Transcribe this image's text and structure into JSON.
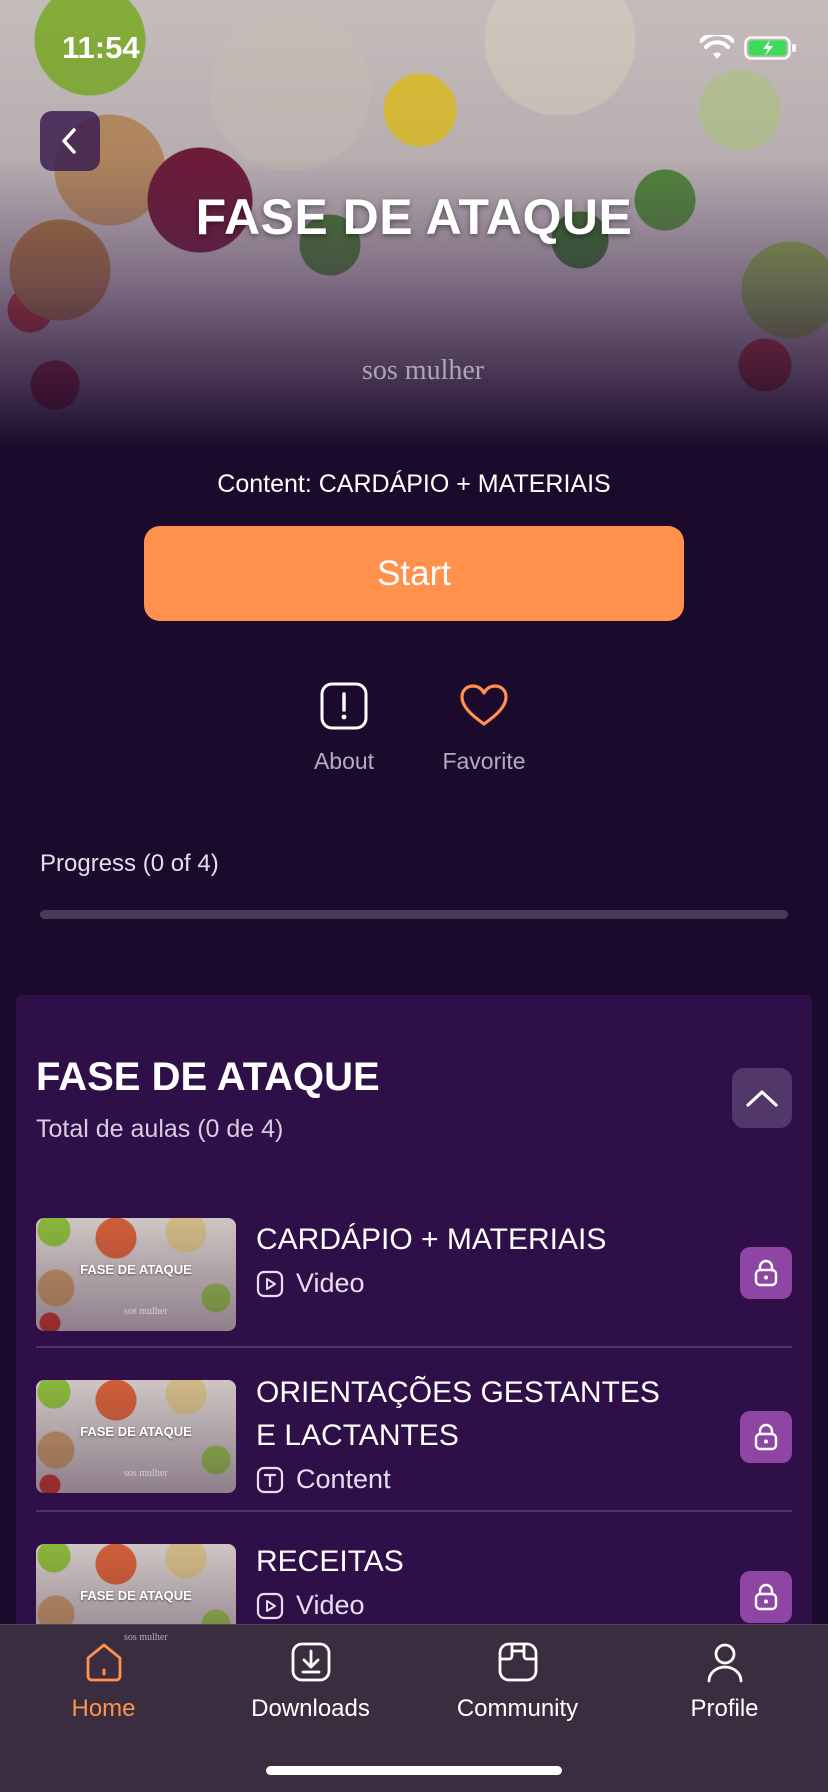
{
  "status_bar": {
    "time": "11:54",
    "wifi_icon": "wifi-icon",
    "battery_icon": "battery-charging-icon"
  },
  "hero": {
    "title": "FASE DE ATAQUE",
    "logo_text": "sos mulher",
    "back_icon": "chevron-left-icon"
  },
  "course": {
    "content_label": "Content: CARDÁPIO + MATERIAIS",
    "start_label": "Start",
    "about_label": "About",
    "favorite_label": "Favorite",
    "progress_label": "Progress (0 of 4)",
    "progress_fraction": 0
  },
  "module": {
    "title": "FASE DE ATAQUE",
    "subtitle": "Total de aulas (0 de 4)",
    "collapse_icon": "chevron-up-icon",
    "lessons": [
      {
        "title": "CARDÁPIO + MATERIAIS",
        "type": "Video",
        "type_icon": "play-square-icon",
        "thumb_title": "FASE DE ATAQUE",
        "thumb_logo": "sos mulher",
        "locked": true
      },
      {
        "title": "ORIENTAÇÕES GESTANTES E LACTANTES",
        "type": "Content",
        "type_icon": "text-square-icon",
        "thumb_title": "FASE DE ATAQUE",
        "thumb_logo": "sos mulher",
        "locked": true
      },
      {
        "title": "RECEITAS",
        "type": "Video",
        "type_icon": "play-square-icon",
        "thumb_title": "FASE DE ATAQUE",
        "thumb_logo": "sos mulher",
        "locked": true
      }
    ]
  },
  "tabbar": {
    "items": [
      {
        "label": "Home",
        "icon": "home-icon",
        "active": true
      },
      {
        "label": "Downloads",
        "icon": "download-icon",
        "active": false
      },
      {
        "label": "Community",
        "icon": "community-icon",
        "active": false
      },
      {
        "label": "Profile",
        "icon": "profile-icon",
        "active": false
      }
    ]
  },
  "colors": {
    "background": "#1c0a2c",
    "accent": "#ff914d",
    "module_card": "#2f0f48",
    "lock_button": "#8f45a3",
    "tabbar": "#3a2d3f"
  }
}
